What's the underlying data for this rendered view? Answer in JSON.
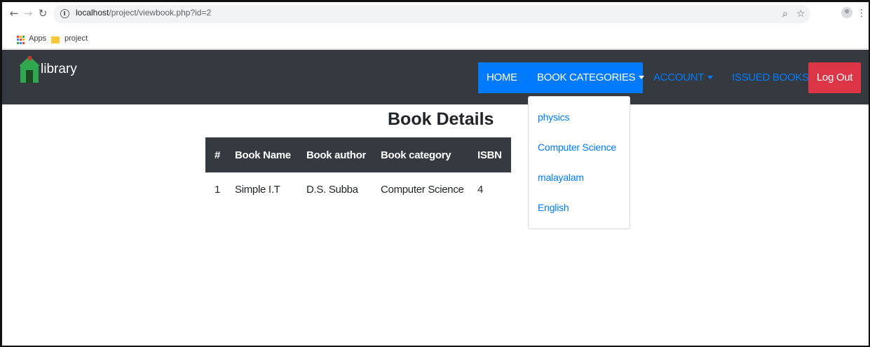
{
  "browser": {
    "url_host": "localhost",
    "url_path": "/project/viewbook.php?id=2",
    "bookmarks": [
      {
        "label": "Apps",
        "icon": "apps-icon"
      },
      {
        "label": "project",
        "icon": "folder-icon"
      }
    ]
  },
  "navbar": {
    "brand": "library",
    "items": {
      "home": "HOME",
      "book_categories": "BOOK CATEGORIES",
      "account": "ACCOUNT",
      "issued_books": "ISSUED BOOKS",
      "logout": "Log Out"
    },
    "colors": {
      "navbar_bg": "#343a40",
      "primary": "#007bff",
      "danger": "#dc3545"
    }
  },
  "dropdown": {
    "items": [
      "physics",
      "Computer Science",
      "malayalam",
      "English"
    ]
  },
  "main": {
    "title": "Book Details",
    "table": {
      "headers": [
        "#",
        "Book Name",
        "Book author",
        "Book category",
        "ISBN"
      ],
      "rows": [
        [
          "1",
          "Simple I.T",
          "D.S. Subba",
          "Computer Science",
          "4"
        ]
      ]
    }
  }
}
